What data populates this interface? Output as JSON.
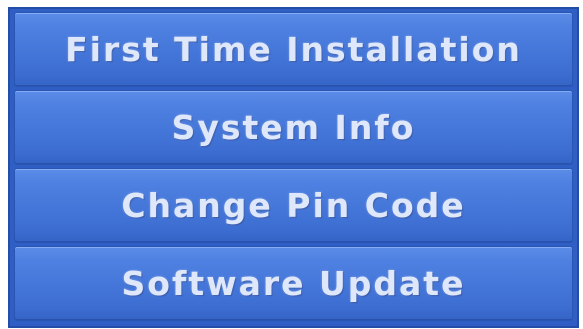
{
  "menu": {
    "items": [
      {
        "label": "First Time Installation"
      },
      {
        "label": "System Info"
      },
      {
        "label": "Change Pin Code"
      },
      {
        "label": "Software Update"
      }
    ]
  },
  "colors": {
    "menu_background": "#2f5fc4",
    "item_top": "#5b8ce8",
    "item_bottom": "#3563c6",
    "text": "#dfe8fb"
  }
}
